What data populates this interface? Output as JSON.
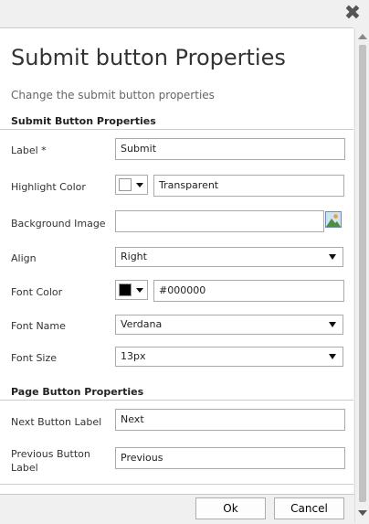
{
  "dialog": {
    "title": "Submit button Properties",
    "subtitle": "Change the submit button properties"
  },
  "sections": {
    "submit": "Submit Button Properties",
    "page": "Page Button Properties"
  },
  "fields": {
    "label": {
      "label": "Label *",
      "value": "Submit"
    },
    "highlight_color": {
      "label": "Highlight Color",
      "value": "Transparent",
      "swatch": "#ffffff"
    },
    "background_image": {
      "label": "Background Image",
      "value": ""
    },
    "align": {
      "label": "Align",
      "value": "Right"
    },
    "font_color": {
      "label": "Font Color",
      "value": "#000000",
      "swatch": "#000000"
    },
    "font_name": {
      "label": "Font Name",
      "value": "Verdana"
    },
    "font_size": {
      "label": "Font Size",
      "value": "13px"
    },
    "next_label": {
      "label": "Next Button Label",
      "value": "Next"
    },
    "prev_label": {
      "label": "Previous Button Label",
      "value": "Previous"
    }
  },
  "buttons": {
    "ok": "Ok",
    "cancel": "Cancel"
  },
  "icons": {
    "close": "close-icon",
    "image": "image-picker-icon"
  }
}
